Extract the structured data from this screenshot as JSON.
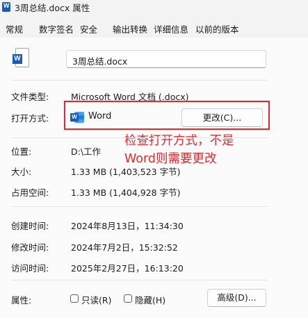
{
  "window": {
    "title": "3周总结.docx 属性"
  },
  "tabs": [
    {
      "label": "常规"
    },
    {
      "label": "数字签名"
    },
    {
      "label": "安全"
    },
    {
      "label": "输出转换"
    },
    {
      "label": "详细信息"
    },
    {
      "label": "以前的版本"
    }
  ],
  "file": {
    "name": "3周总结.docx"
  },
  "properties": {
    "type_label": "文件类型:",
    "type_value": "Microsoft Word 文档 (.docx)",
    "open_with_label": "打开方式:",
    "open_with_app": "Word",
    "change_button": "更改(C)...",
    "location_label": "位置:",
    "location_value": "D:\\工作",
    "size_label": "大小:",
    "size_value": "1.33 MB (1,403,523 字节)",
    "disk_size_label": "占用空间:",
    "disk_size_value": "1.33 MB (1,404,928 字节)",
    "created_label": "创建时间:",
    "created_value": "2024年8月13日，11:34:30",
    "modified_label": "修改时间:",
    "modified_value": "2024年7月2日，15:32:52",
    "accessed_label": "访问时间:",
    "accessed_value": "2025年2月27日，16:13:20",
    "attributes_label": "属性:",
    "readonly_label": "只读(R)",
    "readonly_checked": false,
    "hidden_label": "隐藏(H)",
    "hidden_checked": false,
    "advanced_button": "高级(D)..."
  },
  "annotation": {
    "line1": "检查打开方式，不是",
    "line2": "Word则需要更改",
    "color": "#e8262b"
  },
  "icons": {
    "title_icon": "word-doc-icon",
    "file_icon": "word-doc-icon",
    "app_icon": "word-app-icon"
  }
}
